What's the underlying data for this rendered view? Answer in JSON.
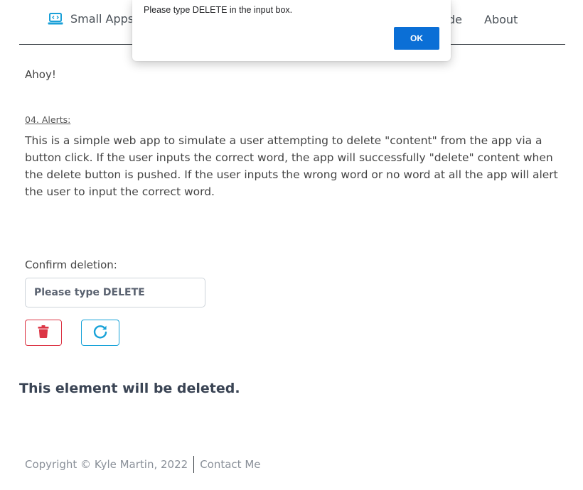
{
  "header": {
    "brand": "Small Apps",
    "nav": {
      "guide_partial": "de",
      "about": "About"
    }
  },
  "main": {
    "greeting": "Ahoy!",
    "section_title": "04. Alerts:",
    "description": "This is a simple web app to simulate a user attempting to delete \"content\" from the app via a button click. If the user inputs the correct word, the app will successfully \"delete\" content when the delete button is pushed. If the user inputs the wrong word or no word at all the app will alert the user to input the correct word.",
    "confirm_label": "Confirm deletion:",
    "confirm_input": {
      "value": "",
      "placeholder": "Please type DELETE"
    },
    "delete_button_icon": "trash-icon",
    "reset_button_icon": "redo-icon",
    "target_text": "This element will be deleted."
  },
  "footer": {
    "copyright": "Copyright © Kyle Martin, 2022",
    "contact": "Contact Me"
  },
  "alert": {
    "message": "Please type DELETE in the input box.",
    "ok_label": "OK"
  },
  "colors": {
    "delete": "#dc3545",
    "reset": "#17a2d8",
    "ok_button": "#0b6fd6",
    "brand_icon": "#1aa0d8"
  }
}
